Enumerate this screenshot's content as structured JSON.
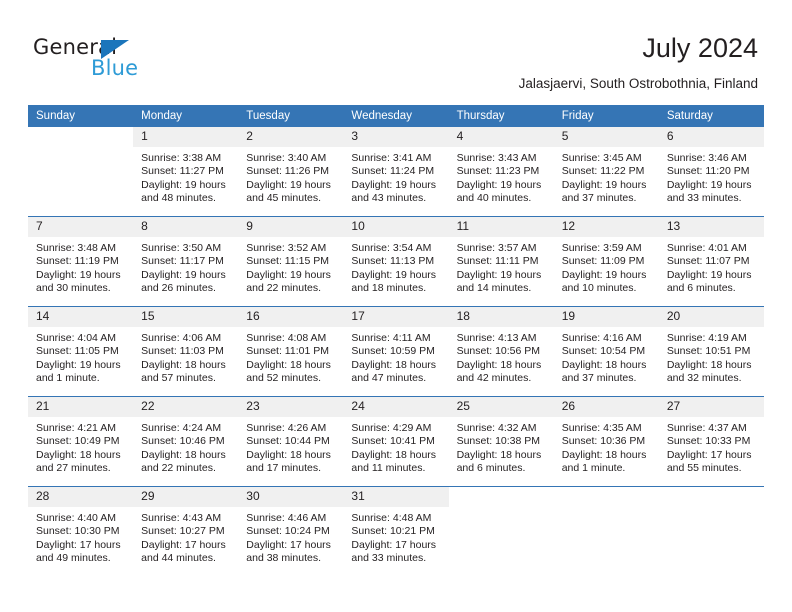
{
  "brand": {
    "line1": "General",
    "line2": "Blue",
    "logo_icon": "blue-triangle-icon"
  },
  "header": {
    "title": "July 2024",
    "location": "Jalasjaervi, South Ostrobothnia, Finland"
  },
  "colors": {
    "header_blue": "#3575b5",
    "brand_dark_blue": "#1b75bb",
    "brand_light_blue": "#2e9bd6",
    "daynum_background": "#f0f0f0",
    "text": "#231f20"
  },
  "weekdays": [
    "Sunday",
    "Monday",
    "Tuesday",
    "Wednesday",
    "Thursday",
    "Friday",
    "Saturday"
  ],
  "weeks": [
    [
      {
        "day": "",
        "info": ""
      },
      {
        "day": "1",
        "info": "Sunrise: 3:38 AM\nSunset: 11:27 PM\nDaylight: 19 hours\nand 48 minutes."
      },
      {
        "day": "2",
        "info": "Sunrise: 3:40 AM\nSunset: 11:26 PM\nDaylight: 19 hours\nand 45 minutes."
      },
      {
        "day": "3",
        "info": "Sunrise: 3:41 AM\nSunset: 11:24 PM\nDaylight: 19 hours\nand 43 minutes."
      },
      {
        "day": "4",
        "info": "Sunrise: 3:43 AM\nSunset: 11:23 PM\nDaylight: 19 hours\nand 40 minutes."
      },
      {
        "day": "5",
        "info": "Sunrise: 3:45 AM\nSunset: 11:22 PM\nDaylight: 19 hours\nand 37 minutes."
      },
      {
        "day": "6",
        "info": "Sunrise: 3:46 AM\nSunset: 11:20 PM\nDaylight: 19 hours\nand 33 minutes."
      }
    ],
    [
      {
        "day": "7",
        "info": "Sunrise: 3:48 AM\nSunset: 11:19 PM\nDaylight: 19 hours\nand 30 minutes."
      },
      {
        "day": "8",
        "info": "Sunrise: 3:50 AM\nSunset: 11:17 PM\nDaylight: 19 hours\nand 26 minutes."
      },
      {
        "day": "9",
        "info": "Sunrise: 3:52 AM\nSunset: 11:15 PM\nDaylight: 19 hours\nand 22 minutes."
      },
      {
        "day": "10",
        "info": "Sunrise: 3:54 AM\nSunset: 11:13 PM\nDaylight: 19 hours\nand 18 minutes."
      },
      {
        "day": "11",
        "info": "Sunrise: 3:57 AM\nSunset: 11:11 PM\nDaylight: 19 hours\nand 14 minutes."
      },
      {
        "day": "12",
        "info": "Sunrise: 3:59 AM\nSunset: 11:09 PM\nDaylight: 19 hours\nand 10 minutes."
      },
      {
        "day": "13",
        "info": "Sunrise: 4:01 AM\nSunset: 11:07 PM\nDaylight: 19 hours\nand 6 minutes."
      }
    ],
    [
      {
        "day": "14",
        "info": "Sunrise: 4:04 AM\nSunset: 11:05 PM\nDaylight: 19 hours\nand 1 minute."
      },
      {
        "day": "15",
        "info": "Sunrise: 4:06 AM\nSunset: 11:03 PM\nDaylight: 18 hours\nand 57 minutes."
      },
      {
        "day": "16",
        "info": "Sunrise: 4:08 AM\nSunset: 11:01 PM\nDaylight: 18 hours\nand 52 minutes."
      },
      {
        "day": "17",
        "info": "Sunrise: 4:11 AM\nSunset: 10:59 PM\nDaylight: 18 hours\nand 47 minutes."
      },
      {
        "day": "18",
        "info": "Sunrise: 4:13 AM\nSunset: 10:56 PM\nDaylight: 18 hours\nand 42 minutes."
      },
      {
        "day": "19",
        "info": "Sunrise: 4:16 AM\nSunset: 10:54 PM\nDaylight: 18 hours\nand 37 minutes."
      },
      {
        "day": "20",
        "info": "Sunrise: 4:19 AM\nSunset: 10:51 PM\nDaylight: 18 hours\nand 32 minutes."
      }
    ],
    [
      {
        "day": "21",
        "info": "Sunrise: 4:21 AM\nSunset: 10:49 PM\nDaylight: 18 hours\nand 27 minutes."
      },
      {
        "day": "22",
        "info": "Sunrise: 4:24 AM\nSunset: 10:46 PM\nDaylight: 18 hours\nand 22 minutes."
      },
      {
        "day": "23",
        "info": "Sunrise: 4:26 AM\nSunset: 10:44 PM\nDaylight: 18 hours\nand 17 minutes."
      },
      {
        "day": "24",
        "info": "Sunrise: 4:29 AM\nSunset: 10:41 PM\nDaylight: 18 hours\nand 11 minutes."
      },
      {
        "day": "25",
        "info": "Sunrise: 4:32 AM\nSunset: 10:38 PM\nDaylight: 18 hours\nand 6 minutes."
      },
      {
        "day": "26",
        "info": "Sunrise: 4:35 AM\nSunset: 10:36 PM\nDaylight: 18 hours\nand 1 minute."
      },
      {
        "day": "27",
        "info": "Sunrise: 4:37 AM\nSunset: 10:33 PM\nDaylight: 17 hours\nand 55 minutes."
      }
    ],
    [
      {
        "day": "28",
        "info": "Sunrise: 4:40 AM\nSunset: 10:30 PM\nDaylight: 17 hours\nand 49 minutes."
      },
      {
        "day": "29",
        "info": "Sunrise: 4:43 AM\nSunset: 10:27 PM\nDaylight: 17 hours\nand 44 minutes."
      },
      {
        "day": "30",
        "info": "Sunrise: 4:46 AM\nSunset: 10:24 PM\nDaylight: 17 hours\nand 38 minutes."
      },
      {
        "day": "31",
        "info": "Sunrise: 4:48 AM\nSunset: 10:21 PM\nDaylight: 17 hours\nand 33 minutes."
      },
      {
        "day": "",
        "info": ""
      },
      {
        "day": "",
        "info": ""
      },
      {
        "day": "",
        "info": ""
      }
    ]
  ]
}
